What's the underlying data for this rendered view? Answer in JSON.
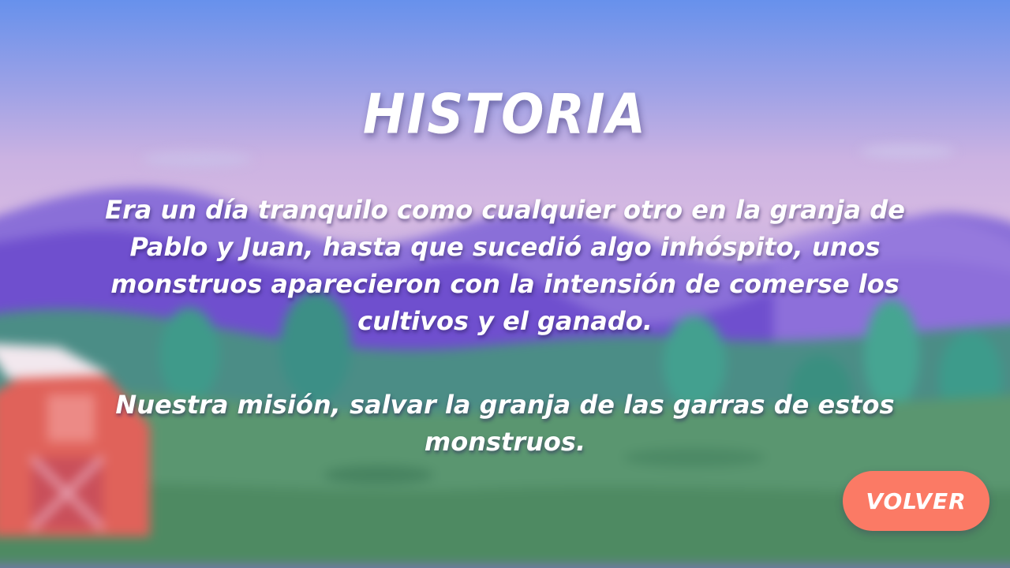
{
  "screen": {
    "title": "Historia",
    "paragraphs": [
      "Era un día tranquilo como cualquier otro en la granja de Pablo y Juan, hasta que sucedió algo inhóspito, unos monstruos aparecieron con la intensión de comerse los cultivos y el ganado.",
      "Nuestra misión, salvar la granja de las garras de estos monstruos."
    ],
    "back_button_label": "Volver"
  },
  "colors": {
    "sky_top": "#6791ec",
    "sky_mid": "#d5b9e2",
    "mountains": "#7b5fd6",
    "hills": "#4f8f7a",
    "grass": "#5f9a6e",
    "barn": "#e0625a",
    "button": "#fb7a65",
    "text": "#ffffff"
  },
  "icons": {
    "background": "farm-landscape-background"
  }
}
